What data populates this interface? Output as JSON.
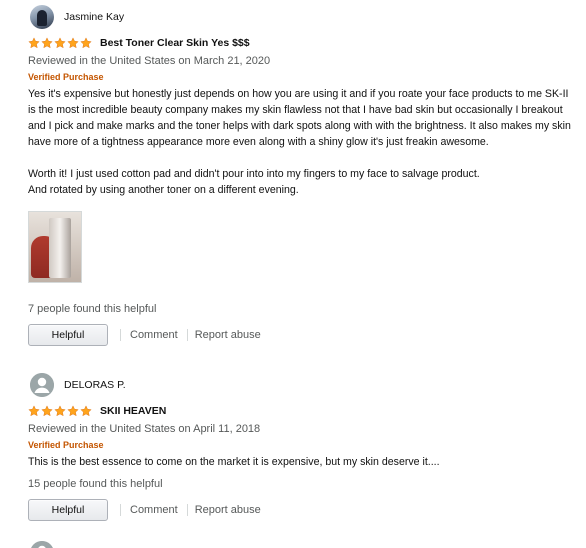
{
  "reviews": [
    {
      "profile_name": "Jasmine Kay",
      "rating": 5,
      "title": "Best Toner Clear Skin Yes $$$",
      "date_line": "Reviewed in the United States on March 21, 2020",
      "verified": "Verified Purchase",
      "body_p1": "Yes it's expensive but honestly just depends on how you are using it and if you roate your face products to me SK-II is the most incredible beauty company makes my skin flawless not that I have bad skin but occasionally I breakout and I pick and make marks and the toner helps with dark spots along with with the brightness. It also makes my skin have more of a tightness appearance more even along with a shiny glow it's just freakin awesome.",
      "body_p2": "Worth it! I just used cotton pad and didn't pour into into my fingers to my face to salvage product.\nAnd rotated by using another toner on a different evening.",
      "helpful_count": "7 people found this helpful",
      "helpful_label": "Helpful",
      "comment_label": "Comment",
      "report_label": "Report abuse"
    },
    {
      "profile_name": "DELORAS P.",
      "rating": 5,
      "title": "SKII HEAVEN",
      "date_line": "Reviewed in the United States on April 11, 2018",
      "verified": "Verified Purchase",
      "body_p1": "This is the best essence to come on the market it is expensive, but my skin deserve it....",
      "helpful_count": "15 people found this helpful",
      "helpful_label": "Helpful",
      "comment_label": "Comment",
      "report_label": "Report abuse"
    }
  ],
  "colors": {
    "star": "#ffa41c",
    "verified": "#c45500",
    "muted": "#565959"
  },
  "icons": {
    "star": "star-icon",
    "default_avatar": "user-silhouette-icon"
  }
}
